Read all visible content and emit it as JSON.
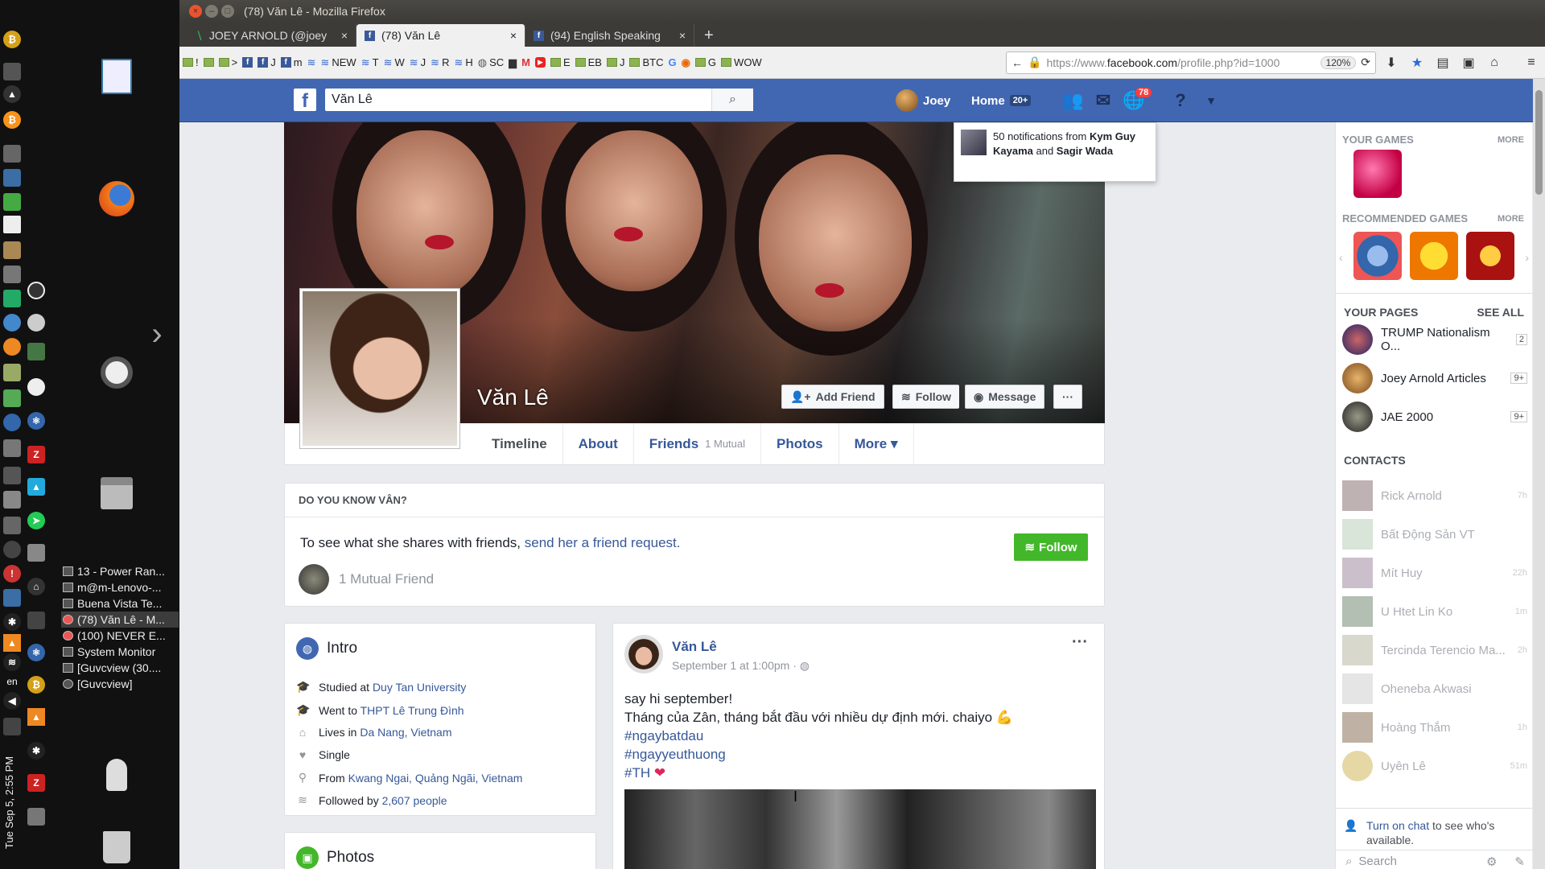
{
  "desktop": {
    "clock": "Tue Sep 5, 2:55 PM",
    "lang": "en",
    "tasks": [
      "13 - Power Ran...",
      "m@m-Lenovo-...",
      "Buena Vista Te...",
      "(78) Văn Lê - M...",
      "(100) NEVER E...",
      "System Monitor",
      "[Guvcview (30....",
      "[Guvcview]"
    ]
  },
  "browser": {
    "window_title": "(78) Văn Lê - Mozilla Firefox",
    "tabs": [
      "JOEY ARNOLD (@joey",
      "(78) Văn Lê",
      "(94) English Speaking"
    ],
    "bookmarks": [
      "!",
      ">",
      "J",
      "m",
      "NEW",
      "T",
      "W",
      "J",
      "R",
      "H",
      "SC",
      "E",
      "EB",
      "J",
      "BTC",
      "G",
      "G",
      "WOW"
    ],
    "url_prefix": "https://www.",
    "url_domain": "facebook.com",
    "url_rest": "/profile.php?id=1000",
    "zoom": "120%"
  },
  "facebook": {
    "search_value": "Văn Lê",
    "user_name": "Joey",
    "home_label": "Home",
    "home_count": "20+",
    "notif_badge": "78",
    "notif_popup": {
      "pre": "50 notifications from ",
      "name1": "Kym Guy Kayama",
      "mid": " and ",
      "name2": "Sagir Wada"
    },
    "profile": {
      "name": "Văn Lê",
      "add_friend": "Add Friend",
      "follow": "Follow",
      "message": "Message",
      "more_dots": "···"
    },
    "profile_tabs": {
      "timeline": "Timeline",
      "about": "About",
      "friends": "Friends",
      "friends_mutual": "1 Mutual",
      "photos": "Photos",
      "more": "More ▾"
    },
    "dyk": {
      "header": "DO YOU KNOW VÂN?",
      "text": "To see what she shares with friends, ",
      "link": "send her a friend request.",
      "follow_btn": "Follow",
      "mutual": "1 Mutual Friend"
    },
    "intro": {
      "title": "Intro",
      "rows": [
        {
          "pre": "Studied at ",
          "link": "Duy Tan University"
        },
        {
          "pre": "Went to ",
          "link": "THPT Lê Trung Đình"
        },
        {
          "pre": "Lives in ",
          "link": "Da Nang, Vietnam"
        },
        {
          "pre": "Single",
          "link": ""
        },
        {
          "pre": "From ",
          "link": "Kwang Ngai, Quảng Ngãi, Vietnam"
        },
        {
          "pre": "Followed by ",
          "link": "2,607 people"
        }
      ]
    },
    "photos_title": "Photos",
    "post": {
      "author": "Văn Lê",
      "time": "September 1 at 1:00pm · ",
      "line1": "say hi september!",
      "line2": "Tháng của Zân, tháng bắt đầu với nhiều dự định mới. chaiyo 💪",
      "tag1": "#ngaybatdau",
      "tag2": "#ngayyeuthuong",
      "tag3": "#TH",
      "heart": "❤"
    },
    "right": {
      "your_games": "YOUR GAMES",
      "more": "MORE",
      "recommended": "RECOMMENDED GAMES",
      "your_pages": "YOUR PAGES",
      "see_all": "SEE ALL",
      "pages": [
        {
          "name": "TRUMP Nationalism O...",
          "count": "2"
        },
        {
          "name": "Joey Arnold Articles",
          "count": "9+"
        },
        {
          "name": "JAE 2000",
          "count": "9+"
        }
      ],
      "contacts_title": "CONTACTS",
      "contacts": [
        {
          "name": "Rick Arnold",
          "time": "7h"
        },
        {
          "name": "Bất Động Sản VT",
          "time": ""
        },
        {
          "name": "Mít Huy",
          "time": "22h"
        },
        {
          "name": "U Htet Lin Ko",
          "time": "1m"
        },
        {
          "name": "Tercinda Terencio Ma...",
          "time": "2h"
        },
        {
          "name": "Oheneba Akwasi",
          "time": ""
        },
        {
          "name": "Hoàng Thắm",
          "time": "1h"
        },
        {
          "name": "Uyên Lê",
          "time": "51m"
        }
      ],
      "chat_link": "Turn on chat",
      "chat_rest": " to see who's available.",
      "chat_search": "Search"
    }
  }
}
